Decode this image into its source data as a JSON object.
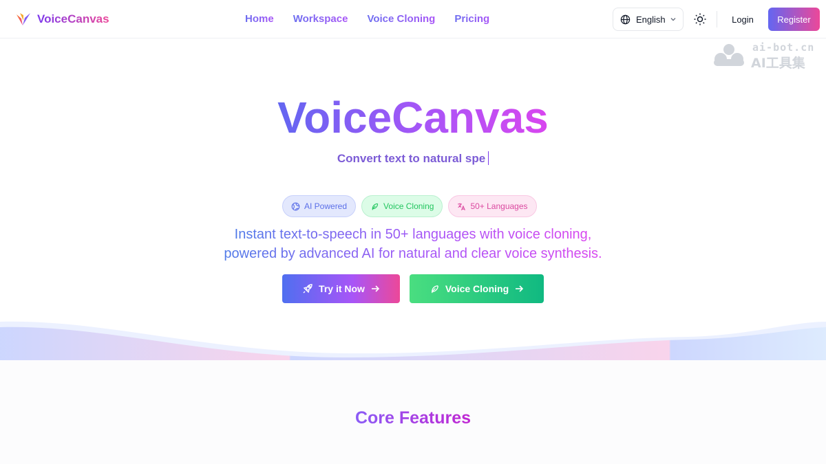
{
  "header": {
    "brand": "VoiceCanvas",
    "nav": [
      "Home",
      "Workspace",
      "Voice Cloning",
      "Pricing"
    ],
    "language": "English",
    "login_label": "Login",
    "register_label": "Register"
  },
  "watermark": {
    "line1": "ai-bot.cn",
    "line2": "AI工具集"
  },
  "hero": {
    "title": "VoiceCanvas",
    "typewriter_text": "Convert text to natural spe",
    "badges": [
      {
        "label": "AI Powered",
        "icon": "globe-icon"
      },
      {
        "label": "Voice Cloning",
        "icon": "feather-icon"
      },
      {
        "label": "50+ Languages",
        "icon": "translate-icon"
      }
    ],
    "description_line1": "Instant text-to-speech in 50+ languages with voice cloning,",
    "description_line2": "powered by advanced AI for natural and clear voice synthesis.",
    "cta_primary": "Try it Now",
    "cta_secondary": "Voice Cloning"
  },
  "features": {
    "title": "Core Features"
  },
  "colors": {
    "brand_gradient_start": "#6366f1",
    "brand_gradient_end": "#ec4899",
    "green_gradient_start": "#4ade80",
    "green_gradient_end": "#10b981",
    "wave_blue": "#c7d2fe",
    "wave_pink": "#fbcfe8"
  }
}
